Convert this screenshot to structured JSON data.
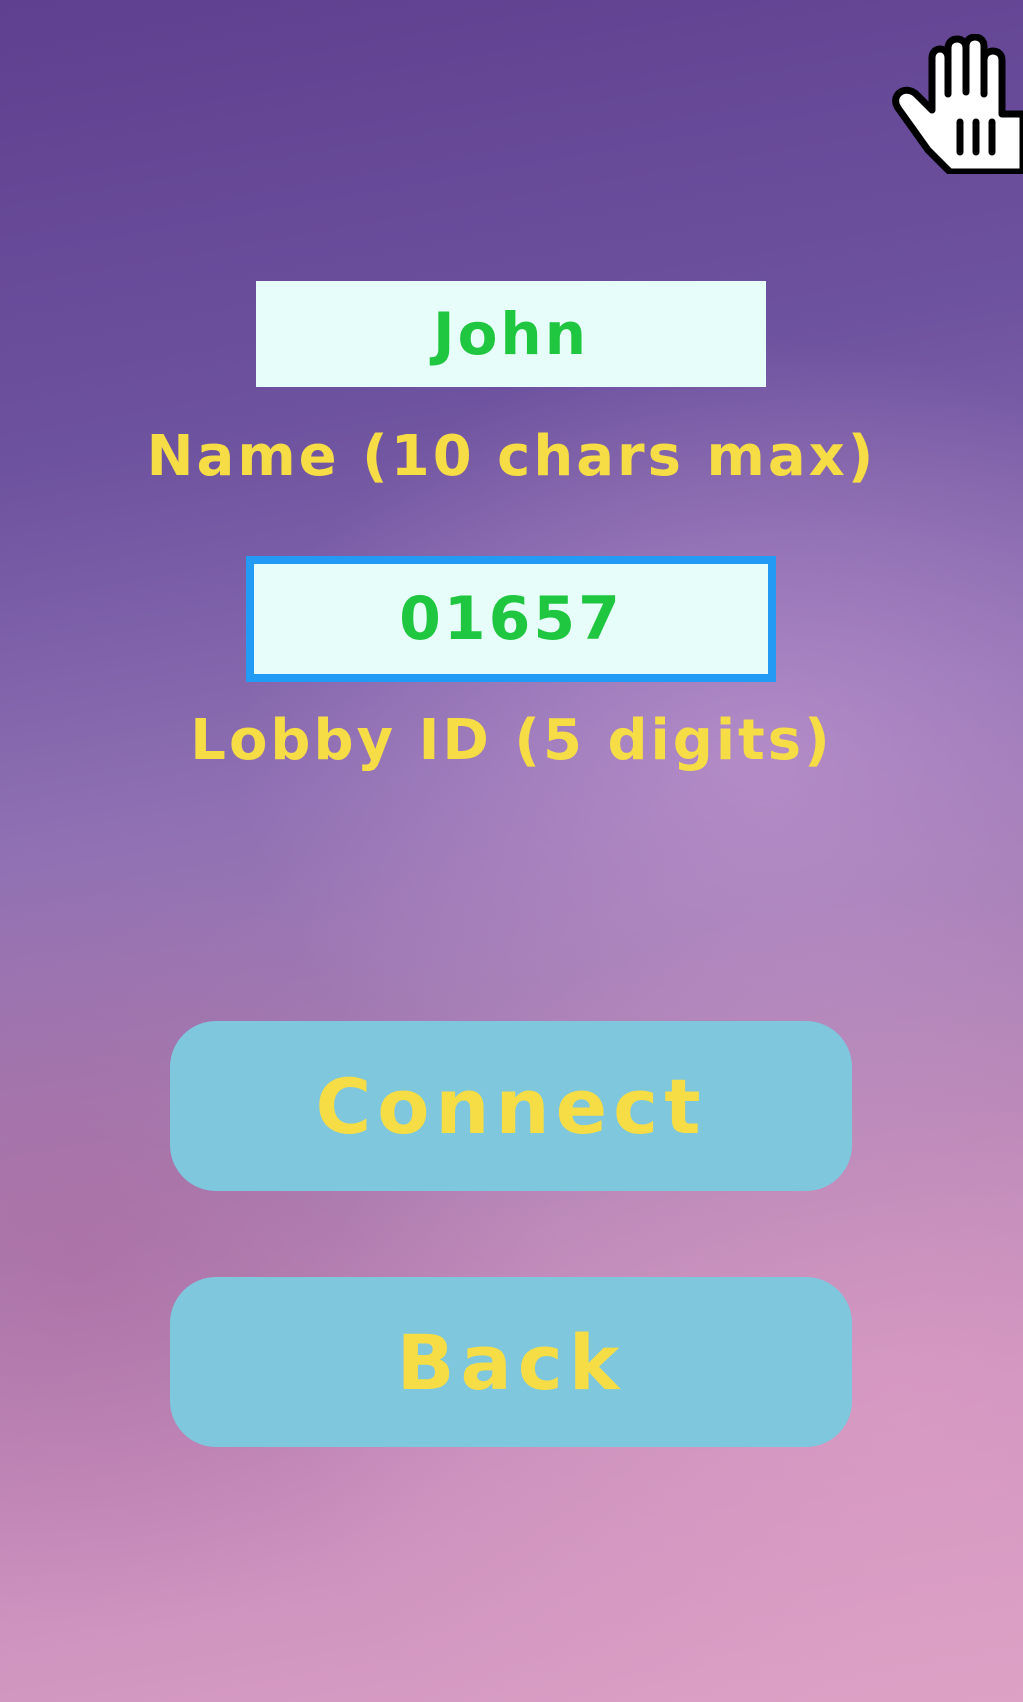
{
  "form": {
    "name_value": "John",
    "name_label": "Name (10 chars max)",
    "lobby_value": "01657",
    "lobby_label": "Lobby ID (5 digits)"
  },
  "buttons": {
    "connect_label": "Connect",
    "back_label": "Back"
  },
  "icons": {
    "corner": "hand-icon"
  },
  "colors": {
    "field_background": "#e6fdf9",
    "field_text": "#1fc63f",
    "focus_border": "#239af3",
    "label_text": "#f6dc45",
    "button_background": "#7ec7dd"
  }
}
